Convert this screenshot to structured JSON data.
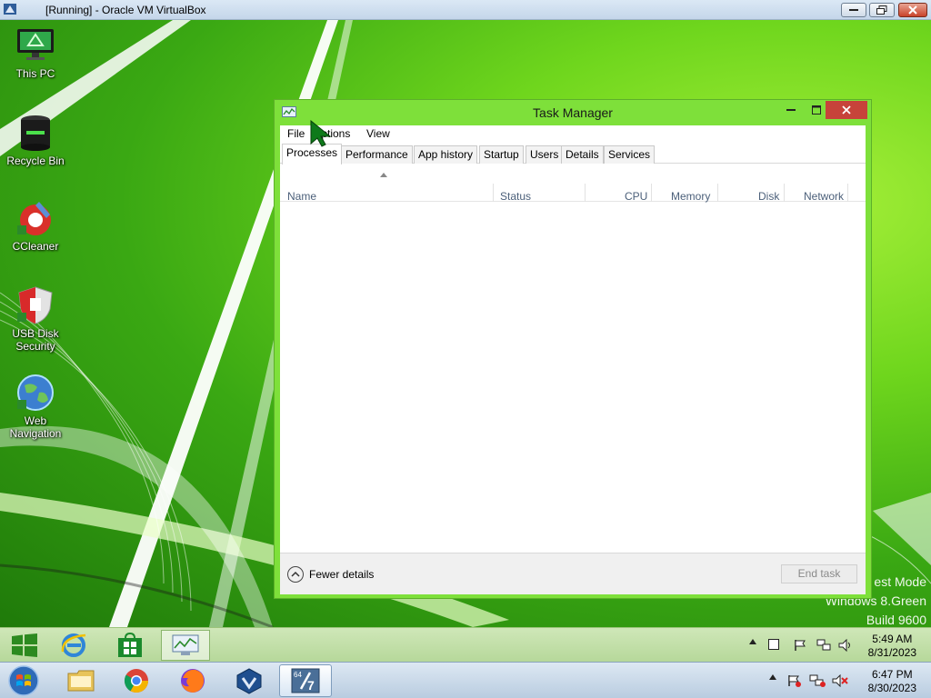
{
  "host_window": {
    "title": "[Running] - Oracle VM VirtualBox",
    "controls": [
      "minimize",
      "restore",
      "close"
    ]
  },
  "desktop": {
    "icons": [
      {
        "label": "This PC",
        "icon": "monitor-icon"
      },
      {
        "label": "Recycle Bin",
        "icon": "recycle-bin-icon"
      },
      {
        "label": "CCleaner",
        "icon": "ccleaner-icon"
      },
      {
        "label": "USB Disk Security",
        "icon": "shield-icon"
      },
      {
        "label": "Web Navigation",
        "icon": "globe-icon"
      }
    ],
    "watermark": [
      "est Mode",
      "Windows 8.Green",
      "Build 9600"
    ]
  },
  "task_manager": {
    "title": "Task Manager",
    "menu": [
      "File",
      "Options",
      "View"
    ],
    "tabs": [
      "Processes",
      "Performance",
      "App history",
      "Startup",
      "Users",
      "Details",
      "Services"
    ],
    "active_tab": "Processes",
    "columns": [
      "Name",
      "Status",
      "CPU",
      "Memory",
      "Disk",
      "Network"
    ],
    "rows": [],
    "fewer_details": "Fewer details",
    "end_task": "End task"
  },
  "guest_taskbar": {
    "pinned": [
      "start-icon",
      "internet-explorer-icon",
      "store-icon",
      "task-manager-icon"
    ],
    "active": "task-manager-icon",
    "time": "5:49 AM",
    "date": "8/31/2023"
  },
  "host_taskbar": {
    "pinned": [
      "windows-start-orb-icon",
      "file-explorer-icon",
      "chrome-icon",
      "firefox-icon",
      "virtualbox-icon",
      "win7-64-vm-icon"
    ],
    "active": "win7-64-vm-icon",
    "vm_badge": "64",
    "time": "6:47 PM",
    "date": "8/30/2023"
  },
  "colors": {
    "close_red": "#c7433a",
    "desktop_green": "#6fd61d",
    "window_frame": "#7ee03a"
  }
}
